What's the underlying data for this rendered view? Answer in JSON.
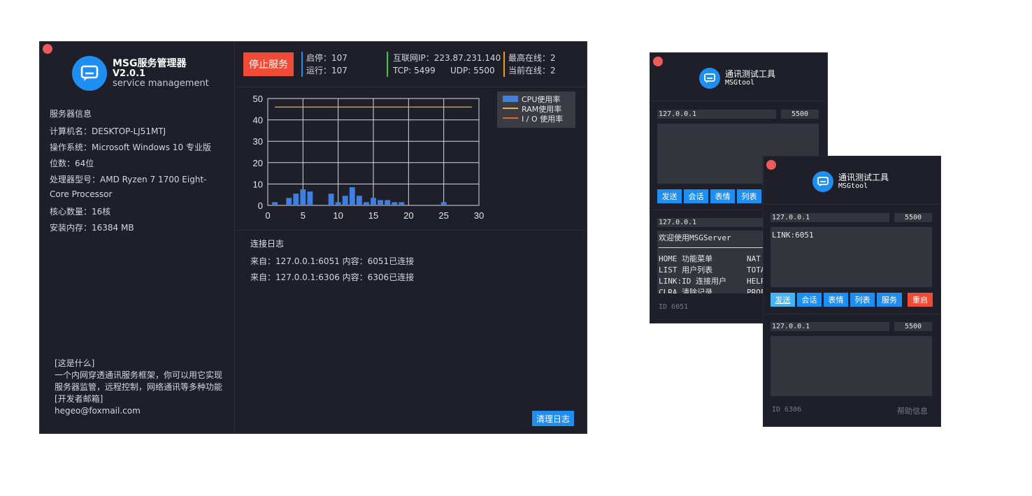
{
  "manager": {
    "app_name": "MSG服务管理器",
    "version": "V2.0.1",
    "subtitle": "service management",
    "server_info_title": "服务器信息",
    "info_lines": [
      "计算机名：DESKTOP-LJ51MTJ",
      "操作系统：Microsoft Windows 10 专业版",
      "位数：64位",
      "处理器型号：AMD Ryzen 7 1700 Eight-",
      "Core Processor",
      "核心数量：16核",
      "安装内存：16384 MB"
    ],
    "footer_lines": [
      "[这是什么]",
      "一个内网穿透通讯服务框架，你可以用它实现",
      "服务器监管，远程控制，网络通讯等多种功能",
      "[开发者邮箱]",
      "hegeo@foxmail.com"
    ],
    "stop_button": "停止服务",
    "stats": {
      "start_stop": "启停：107",
      "running": "运行：107",
      "public_ip": "互联网IP：223.87.231.140",
      "tcp": "TCP: 5499",
      "udp": "UDP: 5500",
      "max_online": "最高在线：2",
      "current_online": "当前在线：2"
    },
    "stat_bar_colors": [
      "#1f8ef1",
      "#2ecc40",
      "#f39c12"
    ],
    "log_title": "连接日志",
    "log_lines": [
      "来自：127.0.0.1:6051 内容：6051已连接",
      "来自：127.0.0.1:6306 内容：6306已连接"
    ],
    "clear_button": "清理日志"
  },
  "chart_data": {
    "type": "bar",
    "x": [
      1,
      3,
      4,
      5,
      6,
      9,
      10,
      11,
      12,
      13,
      14,
      15,
      16,
      17,
      18,
      19,
      25
    ],
    "series": [
      {
        "name": "CPU使用率",
        "kind": "bar",
        "color": "#3f7fe0",
        "values": [
          1.5,
          3.5,
          5.5,
          7.5,
          6.5,
          5.5,
          1.5,
          4.5,
          8.5,
          4.5,
          1.5,
          3.5,
          2.5,
          2.5,
          1.5,
          1.5,
          1.5
        ]
      },
      {
        "name": "RAM使用率",
        "kind": "line",
        "color": "#e8b04a",
        "x": [
          1,
          29
        ],
        "values": [
          46,
          46
        ]
      },
      {
        "name": "I / O 使用率",
        "kind": "line",
        "color": "#e8662a",
        "x": [],
        "values": []
      }
    ],
    "xlim": [
      0,
      30
    ],
    "ylim": [
      0,
      50
    ],
    "xticks": [
      0,
      5,
      10,
      15,
      20,
      25,
      30
    ],
    "yticks": [
      0,
      10,
      20,
      30,
      40,
      50
    ],
    "grid": true,
    "legend": "top-right"
  },
  "tool1": {
    "title": "通讯测试工具",
    "subtitle": "MSGtool",
    "ip": "127.0.0.1",
    "port": "5500",
    "buttons": [
      "发送",
      "会话",
      "表情",
      "列表"
    ],
    "ip2": "127.0.0.1",
    "welcome": "欢迎使用MSGServer",
    "welcome_right": "在",
    "menu_left": [
      "HOME 功能菜单",
      "LIST 用户列表",
      "LINK:ID 连接用户",
      "CLRA 清除记录"
    ],
    "menu_right": [
      "NAT",
      "TOTA",
      "HELP",
      "PROF"
    ],
    "id_label": "ID 6051"
  },
  "tool2": {
    "title": "通讯测试工具",
    "subtitle": "MSGtool",
    "ip": "127.0.0.1",
    "port": "5500",
    "message": "LINK:6051",
    "buttons": [
      "发送",
      "会话",
      "表情",
      "列表",
      "服务"
    ],
    "restart": "重启",
    "ip2": "127.0.0.1",
    "port2": "5500",
    "id_label": "ID 6306",
    "help": "帮助信息"
  }
}
